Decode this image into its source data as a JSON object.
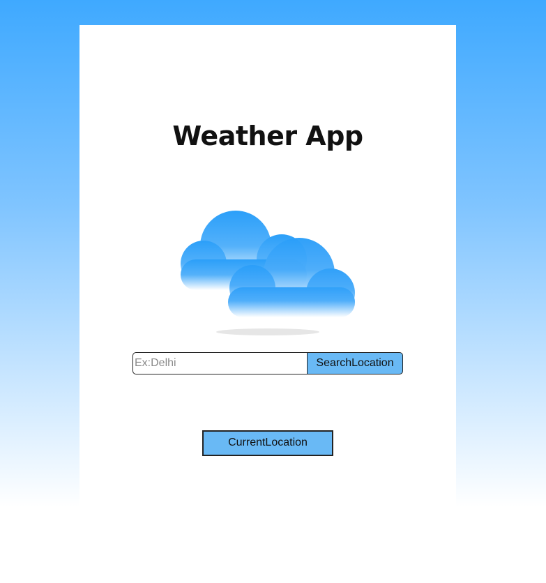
{
  "app": {
    "title": "Weather App"
  },
  "weather_icon": {
    "name": "cloudy-icon",
    "color": "#2b9ff9"
  },
  "search": {
    "placeholder": "Ex:Delhi",
    "value": "",
    "button_label": "SearchLocation"
  },
  "current_location": {
    "button_label": "CurrentLocation"
  },
  "colors": {
    "background_top": "#3fa9ff",
    "background_bottom": "#ffffff",
    "button_fill": "#69b9f5",
    "card": "#ffffff"
  }
}
